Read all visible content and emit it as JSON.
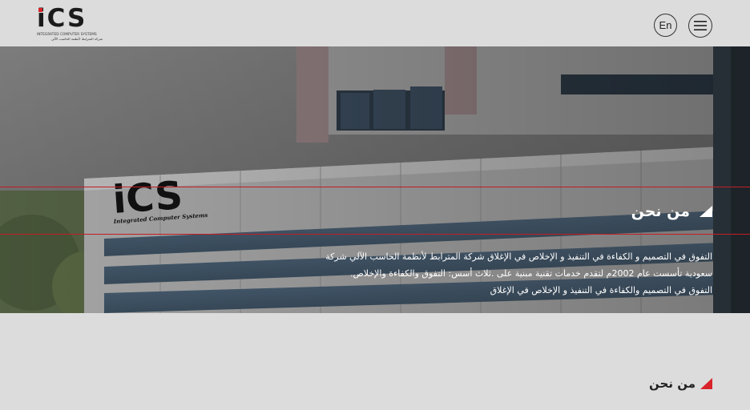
{
  "header": {
    "logo_text": "iCS",
    "logo_subtitle": "INTEGRATED COMPUTER SYSTEMS",
    "logo_subtitle_ar": "شركة المترابط لأنظمة الحاسب الآلي",
    "lang_button": "En",
    "menu_icon": "hamburger-icon"
  },
  "hero": {
    "building_sign": "iCS",
    "building_sign_sub": "Integrated Computer Systems",
    "title": "من نحن",
    "paragraph": [
      "التفوق في التصميم و الكفاءة في التنفيذ و الإخلاص في الإغلاق شركة المترابط لأنظمة الحاسب الآلي شركة",
      "سعودية تأسست عام 2002م لتقدم خدمات تقنية مبنية على .ثلاث أسس: التفوق والكفاءة والإخلاص.",
      "التفوق في التصميم والكفاءة في التنفيذ و الإخلاص في الإغلاق"
    ]
  },
  "section": {
    "title": "من نحن"
  },
  "colors": {
    "accent": "#d8232a",
    "background": "#dcdcdc"
  }
}
